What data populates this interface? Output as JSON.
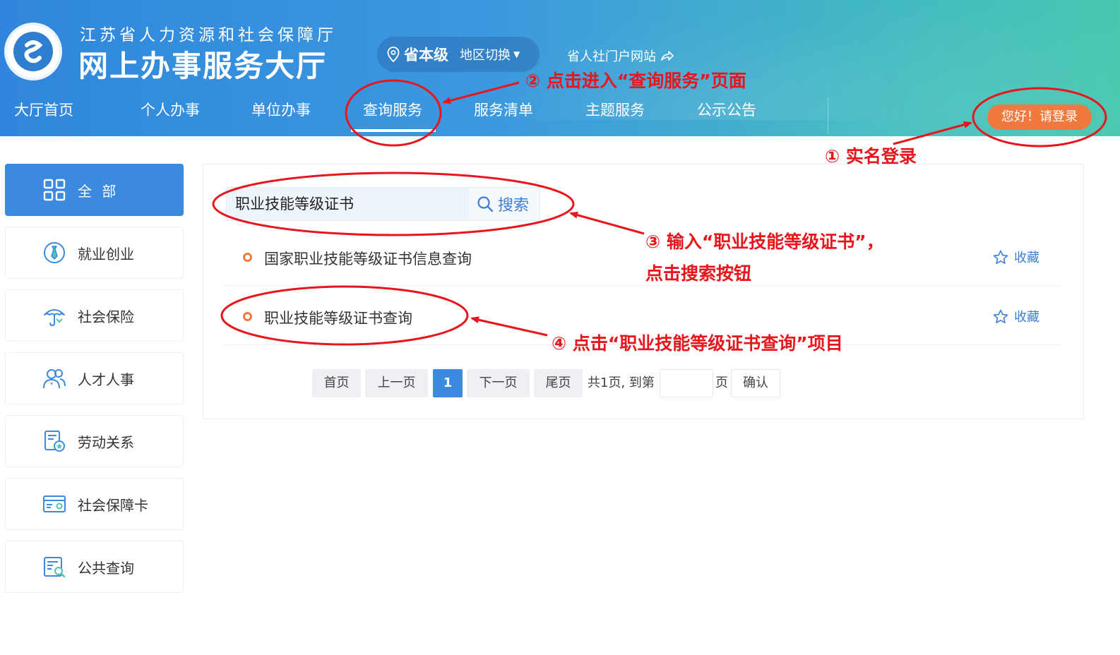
{
  "header": {
    "org_name": "江苏省人力资源和社会保障厅",
    "hall_name": "网上办事服务大厅",
    "region_level": "省本级",
    "region_switch": "地区切换",
    "portal_link": "省人社门户网站",
    "login_button": "您好！请登录",
    "nav": [
      "大厅首页",
      "个人办事",
      "单位办事",
      "查询服务",
      "服务清单",
      "主题服务",
      "公示公告"
    ],
    "active_nav": "查询服务"
  },
  "sidebar": {
    "items": [
      {
        "label": "全 部",
        "icon": "grid-icon",
        "active": true
      },
      {
        "label": "就业创业",
        "icon": "tie-badge-icon"
      },
      {
        "label": "社会保险",
        "icon": "umbrella-icon"
      },
      {
        "label": "人才人事",
        "icon": "people-icon"
      },
      {
        "label": "劳动关系",
        "icon": "document-badge-icon"
      },
      {
        "label": "社会保障卡",
        "icon": "card-icon"
      },
      {
        "label": "公共查询",
        "icon": "search-document-icon"
      }
    ]
  },
  "search": {
    "value": "职业技能等级证书",
    "button_label": "搜索"
  },
  "results": [
    {
      "title": "国家职业技能等级证书信息查询",
      "fav_label": "收藏"
    },
    {
      "title": "职业技能等级证书查询",
      "fav_label": "收藏"
    }
  ],
  "pagination": {
    "first": "首页",
    "prev": "上一页",
    "current": "1",
    "next": "下一页",
    "last": "尾页",
    "total_text": "共1页, 到第",
    "page_suffix": "页",
    "confirm": "确认"
  },
  "annotations": {
    "step1": "① 实名登录",
    "step2": "② 点击进入“查询服务”页面",
    "step3_line1": "③ 输入“职业技能等级证书”，",
    "step3_line2": "点击搜索按钮",
    "step4": "④ 点击“职业技能等级证书查询”项目",
    "color": "#e8161c"
  },
  "colors": {
    "header_start": "#2f86dc",
    "header_end": "#49c7b0",
    "accent": "#3b8ae0",
    "login_orange": "#f07a3e"
  }
}
